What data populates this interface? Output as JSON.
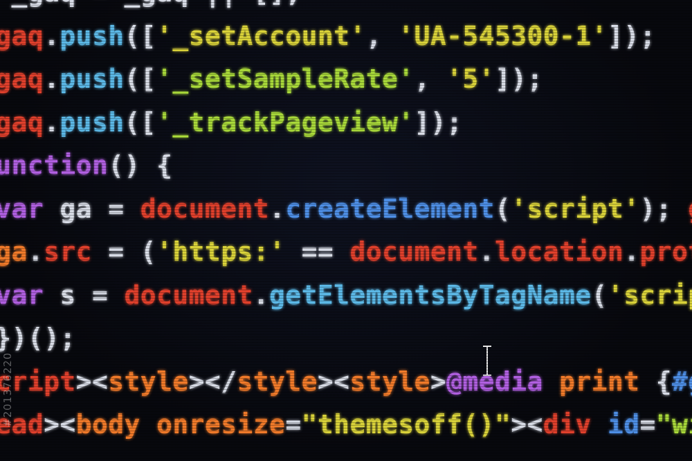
{
  "editor": {
    "theme": "dark",
    "background_color": "#07080d",
    "lines": [
      [
        {
          "t": "  _gaq = _gaq || [];",
          "c": "c-white"
        }
      ],
      [
        {
          "t": "_gaq",
          "c": "c-red"
        },
        {
          "t": ".",
          "c": "c-white"
        },
        {
          "t": "push",
          "c": "c-cyan"
        },
        {
          "t": "([",
          "c": "c-white"
        },
        {
          "t": "'_setAccount'",
          "c": "c-yellow"
        },
        {
          "t": ", ",
          "c": "c-white"
        },
        {
          "t": "'UA-545300-1'",
          "c": "c-yellow"
        },
        {
          "t": "]);",
          "c": "c-white"
        }
      ],
      [
        {
          "t": "_gaq",
          "c": "c-red"
        },
        {
          "t": ".",
          "c": "c-white"
        },
        {
          "t": "push",
          "c": "c-cyan"
        },
        {
          "t": "([",
          "c": "c-white"
        },
        {
          "t": "'_setSampleRate'",
          "c": "c-green"
        },
        {
          "t": ", ",
          "c": "c-white"
        },
        {
          "t": "'5'",
          "c": "c-yellow"
        },
        {
          "t": "]);",
          "c": "c-white"
        }
      ],
      [
        {
          "t": "_gaq",
          "c": "c-red"
        },
        {
          "t": ".",
          "c": "c-white"
        },
        {
          "t": "push",
          "c": "c-cyan"
        },
        {
          "t": "([",
          "c": "c-white"
        },
        {
          "t": "'_trackPageview'",
          "c": "c-green"
        },
        {
          "t": "]);",
          "c": "c-white"
        }
      ],
      [
        {
          "t": "function",
          "c": "c-purple"
        },
        {
          "t": "() {",
          "c": "c-white"
        }
      ],
      [
        {
          "t": " var",
          "c": "c-purple"
        },
        {
          "t": " ga = ",
          "c": "c-white"
        },
        {
          "t": "document",
          "c": "c-red"
        },
        {
          "t": ".",
          "c": "c-white"
        },
        {
          "t": "createElement",
          "c": "c-blue"
        },
        {
          "t": "(",
          "c": "c-white"
        },
        {
          "t": "'script'",
          "c": "c-yellow"
        },
        {
          "t": "); ",
          "c": "c-white"
        },
        {
          "t": "g",
          "c": "c-red"
        }
      ],
      [
        {
          "t": " ga",
          "c": "c-orange"
        },
        {
          "t": ".",
          "c": "c-white"
        },
        {
          "t": "src",
          "c": "c-red"
        },
        {
          "t": " = (",
          "c": "c-white"
        },
        {
          "t": "'https:'",
          "c": "c-yellow"
        },
        {
          "t": " == ",
          "c": "c-white"
        },
        {
          "t": "document",
          "c": "c-red"
        },
        {
          "t": ".",
          "c": "c-white"
        },
        {
          "t": "location",
          "c": "c-red"
        },
        {
          "t": ".",
          "c": "c-white"
        },
        {
          "t": "prot",
          "c": "c-red"
        }
      ],
      [
        {
          "t": " var",
          "c": "c-purple"
        },
        {
          "t": " s = ",
          "c": "c-white"
        },
        {
          "t": "document",
          "c": "c-red"
        },
        {
          "t": ".",
          "c": "c-white"
        },
        {
          "t": "getElementsByTagName",
          "c": "c-cyan"
        },
        {
          "t": "(",
          "c": "c-white"
        },
        {
          "t": "'scrip",
          "c": "c-yellow"
        }
      ],
      [
        {
          "t": " })();",
          "c": "c-white"
        }
      ],
      [
        {
          "t": "script",
          "c": "c-red"
        },
        {
          "t": "><",
          "c": "c-white"
        },
        {
          "t": "style",
          "c": "c-orange"
        },
        {
          "t": "></",
          "c": "c-white"
        },
        {
          "t": "style",
          "c": "c-orange"
        },
        {
          "t": "><",
          "c": "c-white"
        },
        {
          "t": "style",
          "c": "c-orange"
        },
        {
          "t": ">",
          "c": "c-white"
        },
        {
          "t": "@media",
          "c": "c-purple"
        },
        {
          "t": " print",
          "c": "c-orange"
        },
        {
          "t": " {",
          "c": "c-white"
        },
        {
          "t": "#gh",
          "c": "c-blue"
        }
      ],
      [
        {
          "t": "head",
          "c": "c-red"
        },
        {
          "t": "><",
          "c": "c-white"
        },
        {
          "t": "body",
          "c": "c-orange"
        },
        {
          "t": " onresize",
          "c": "c-orange"
        },
        {
          "t": "=",
          "c": "c-white"
        },
        {
          "t": "\"themesoff()\"",
          "c": "c-yellow"
        },
        {
          "t": "><",
          "c": "c-white"
        },
        {
          "t": "div",
          "c": "c-red"
        },
        {
          "t": " id",
          "c": "c-blue"
        },
        {
          "t": "=",
          "c": "c-white"
        },
        {
          "t": "\"wid",
          "c": "c-green"
        }
      ]
    ]
  },
  "cursor": {
    "icon": "text-cursor-icon"
  },
  "watermark": {
    "side_id": "#201376220"
  }
}
